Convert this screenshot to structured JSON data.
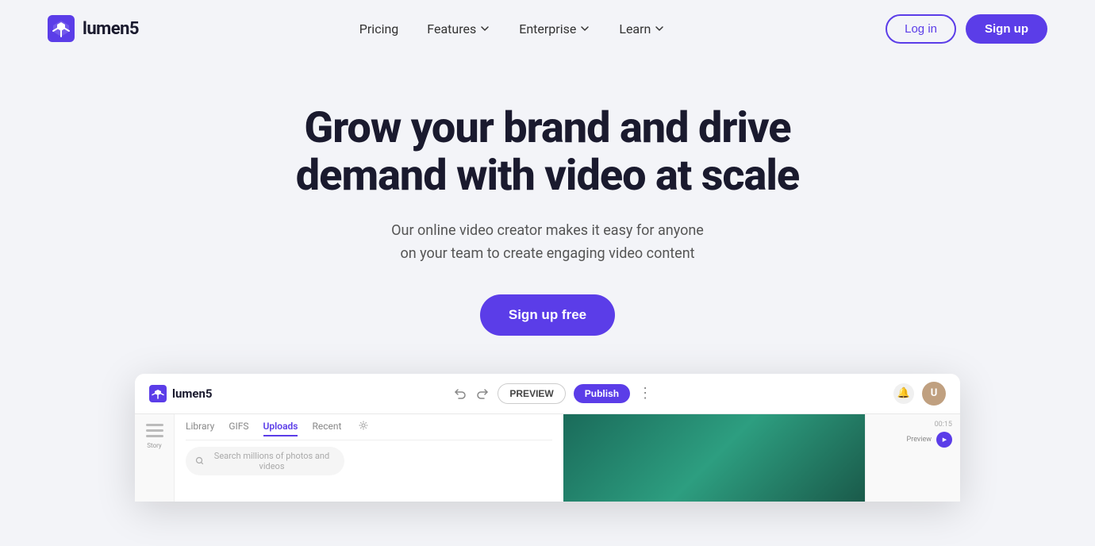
{
  "brand": {
    "name": "lumen5",
    "logo_color": "#5b3de8"
  },
  "navbar": {
    "links": [
      {
        "label": "Pricing",
        "has_dropdown": false
      },
      {
        "label": "Features",
        "has_dropdown": true
      },
      {
        "label": "Enterprise",
        "has_dropdown": true
      },
      {
        "label": "Learn",
        "has_dropdown": true
      }
    ],
    "login_label": "Log in",
    "signup_label": "Sign up"
  },
  "hero": {
    "title_line1": "Grow your brand and drive",
    "title_line2": "demand with video at scale",
    "subtitle_line1": "Our online video creator makes it easy for anyone",
    "subtitle_line2": "on your team to create engaging video content",
    "cta_label": "Sign up free"
  },
  "app_preview": {
    "logo_text": "lumen5",
    "preview_btn": "PREVIEW",
    "publish_btn": "Publish",
    "tabs": [
      "Library",
      "GIFS",
      "Uploads",
      "Recent"
    ],
    "active_tab": "Uploads",
    "search_placeholder": "Search millions of photos and videos",
    "time_display": "00:15",
    "preview_label": "Preview"
  }
}
